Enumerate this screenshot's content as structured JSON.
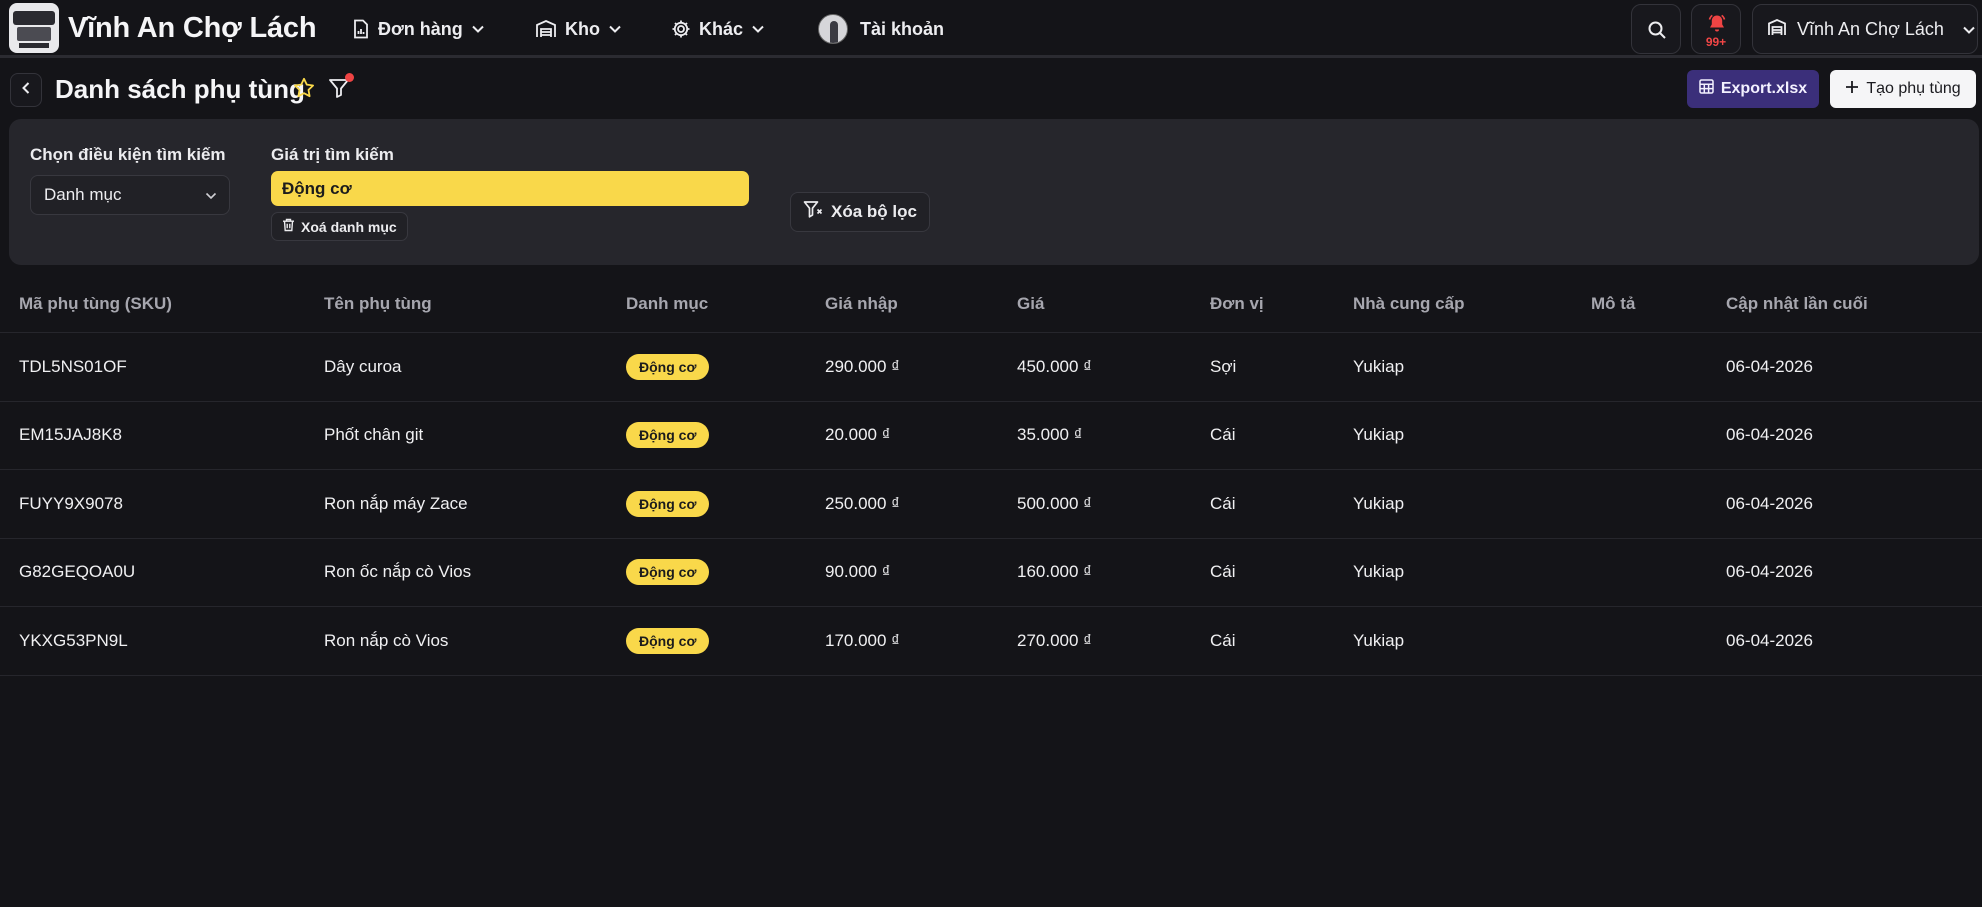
{
  "header": {
    "brand": "Vĩnh An Chợ Lách",
    "nav": [
      {
        "label": "Đơn hàng",
        "icon": "document-chart-icon"
      },
      {
        "label": "Kho",
        "icon": "warehouse-icon"
      },
      {
        "label": "Khác",
        "icon": "gear-icon"
      },
      {
        "label": "Tài khoản",
        "icon": "avatar"
      }
    ],
    "notifications_badge": "99+",
    "shop_name": "Vĩnh An Chợ Lách"
  },
  "page": {
    "title": "Danh sách phụ tùng",
    "export_label": "Export.xlsx",
    "create_label": "Tạo phụ tùng"
  },
  "filter": {
    "condition_label": "Chọn điều kiện tìm kiếm",
    "condition_value": "Danh mục",
    "value_label": "Giá trị tìm kiếm",
    "value": "Động cơ",
    "clear_category_label": "Xoá danh mục",
    "clear_filter_label": "Xóa bộ lọc"
  },
  "table": {
    "columns": [
      "Mã phụ tùng (SKU)",
      "Tên phụ tùng",
      "Danh mục",
      "Giá nhập",
      "Giá",
      "Đơn vị",
      "Nhà cung cấp",
      "Mô tả",
      "Cập nhật lần cuối"
    ],
    "rows": [
      {
        "sku": "TDL5NS01OF",
        "name": "Dây curoa",
        "category": "Động cơ",
        "cost": "290.000 ₫",
        "price": "450.000 ₫",
        "unit": "Sợi",
        "supplier": "Yukiap",
        "description": "",
        "updated": "06-04-2026"
      },
      {
        "sku": "EM15JAJ8K8",
        "name": "Phốt chân git",
        "category": "Động cơ",
        "cost": "20.000 ₫",
        "price": "35.000 ₫",
        "unit": "Cái",
        "supplier": "Yukiap",
        "description": "",
        "updated": "06-04-2026"
      },
      {
        "sku": "FUYY9X9078",
        "name": "Ron nắp máy Zace",
        "category": "Động cơ",
        "cost": "250.000 ₫",
        "price": "500.000 ₫",
        "unit": "Cái",
        "supplier": "Yukiap",
        "description": "",
        "updated": "06-04-2026"
      },
      {
        "sku": "G82GEQOA0U",
        "name": "Ron ốc nắp cò Vios",
        "category": "Động cơ",
        "cost": "90.000 ₫",
        "price": "160.000 ₫",
        "unit": "Cái",
        "supplier": "Yukiap",
        "description": "",
        "updated": "06-04-2026"
      },
      {
        "sku": "YKXG53PN9L",
        "name": "Ron nắp cò Vios",
        "category": "Động cơ",
        "cost": "170.000 ₫",
        "price": "270.000 ₫",
        "unit": "Cái",
        "supplier": "Yukiap",
        "description": "",
        "updated": "06-04-2026"
      }
    ]
  },
  "colors": {
    "background": "#141418",
    "panel": "#26262c",
    "accent_yellow": "#f9d84a",
    "export_purple": "#3b2f7a",
    "alert_red": "#ef4444"
  }
}
